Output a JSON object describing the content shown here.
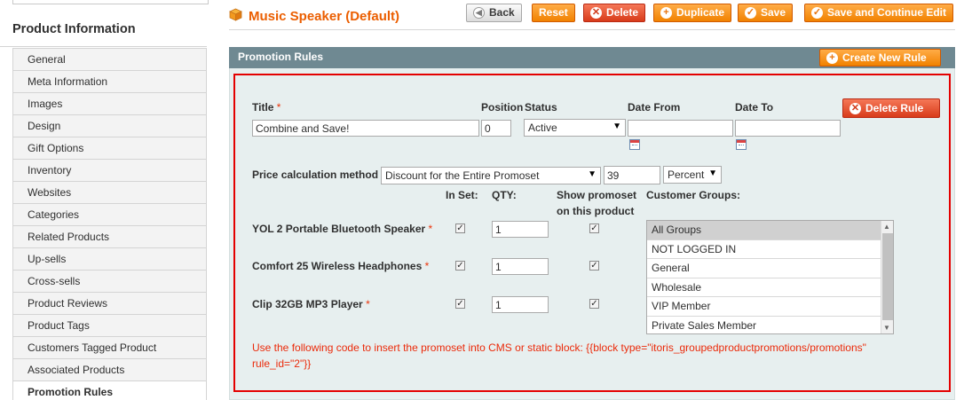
{
  "sidebar": {
    "title": "Product Information",
    "items": [
      {
        "label": "General"
      },
      {
        "label": "Meta Information"
      },
      {
        "label": "Images"
      },
      {
        "label": "Design"
      },
      {
        "label": "Gift Options"
      },
      {
        "label": "Inventory"
      },
      {
        "label": "Websites"
      },
      {
        "label": "Categories"
      },
      {
        "label": "Related Products"
      },
      {
        "label": "Up-sells"
      },
      {
        "label": "Cross-sells"
      },
      {
        "label": "Product Reviews"
      },
      {
        "label": "Product Tags"
      },
      {
        "label": "Customers Tagged Product"
      },
      {
        "label": "Associated Products"
      },
      {
        "label": "Promotion Rules"
      }
    ],
    "active_index": 15
  },
  "header": {
    "title": "Music Speaker (Default)",
    "icon": "product-box-icon",
    "buttons": {
      "back": "Back",
      "reset": "Reset",
      "delete": "Delete",
      "duplicate": "Duplicate",
      "save": "Save",
      "save_continue": "Save and Continue Edit"
    }
  },
  "panel": {
    "title": "Promotion Rules",
    "create_button": "Create New Rule"
  },
  "rule": {
    "labels": {
      "title": "Title",
      "required_mark": "*",
      "position": "Position",
      "status": "Status",
      "date_from": "Date From",
      "date_to": "Date To",
      "price_method": "Price calculation method",
      "in_set": "In Set:",
      "qty": "QTY:",
      "show_promoset_1": "Show promoset",
      "show_promoset_2": "on this product",
      "customer_groups": "Customer Groups:"
    },
    "delete_button": "Delete Rule",
    "title_value": "Combine and Save!",
    "position_value": "0",
    "status_value": "Active",
    "date_from_value": "",
    "date_to_value": "",
    "price_method_value": "Discount for the Entire Promoset",
    "discount_value": "39",
    "discount_type": "Percent",
    "products": [
      {
        "name": "YOL 2 Portable Bluetooth Speaker",
        "in_set": true,
        "qty": "1",
        "show": true
      },
      {
        "name": "Comfort 25 Wireless Headphones",
        "in_set": true,
        "qty": "1",
        "show": true
      },
      {
        "name": "Clip 32GB MP3 Player",
        "in_set": true,
        "qty": "1",
        "show": true
      }
    ],
    "customer_groups": [
      {
        "label": "All Groups",
        "selected": true
      },
      {
        "label": "NOT LOGGED IN",
        "selected": false
      },
      {
        "label": "General",
        "selected": false
      },
      {
        "label": "Wholesale",
        "selected": false
      },
      {
        "label": "VIP Member",
        "selected": false
      },
      {
        "label": "Private Sales Member",
        "selected": false
      }
    ],
    "note": "Use the following code to insert the promoset into CMS or static block: {{block type=\"itoris_groupedproductpromotions/promotions\" rule_id=\"2\"}}"
  },
  "colors": {
    "accent_orange": "#eb5e00",
    "button_orange": "#f18200",
    "button_red": "#d83b1a",
    "panel_header": "#6f8992",
    "panel_body": "#e7efef",
    "highlight_frame": "#e40000",
    "note_red": "#eb2a0a"
  }
}
